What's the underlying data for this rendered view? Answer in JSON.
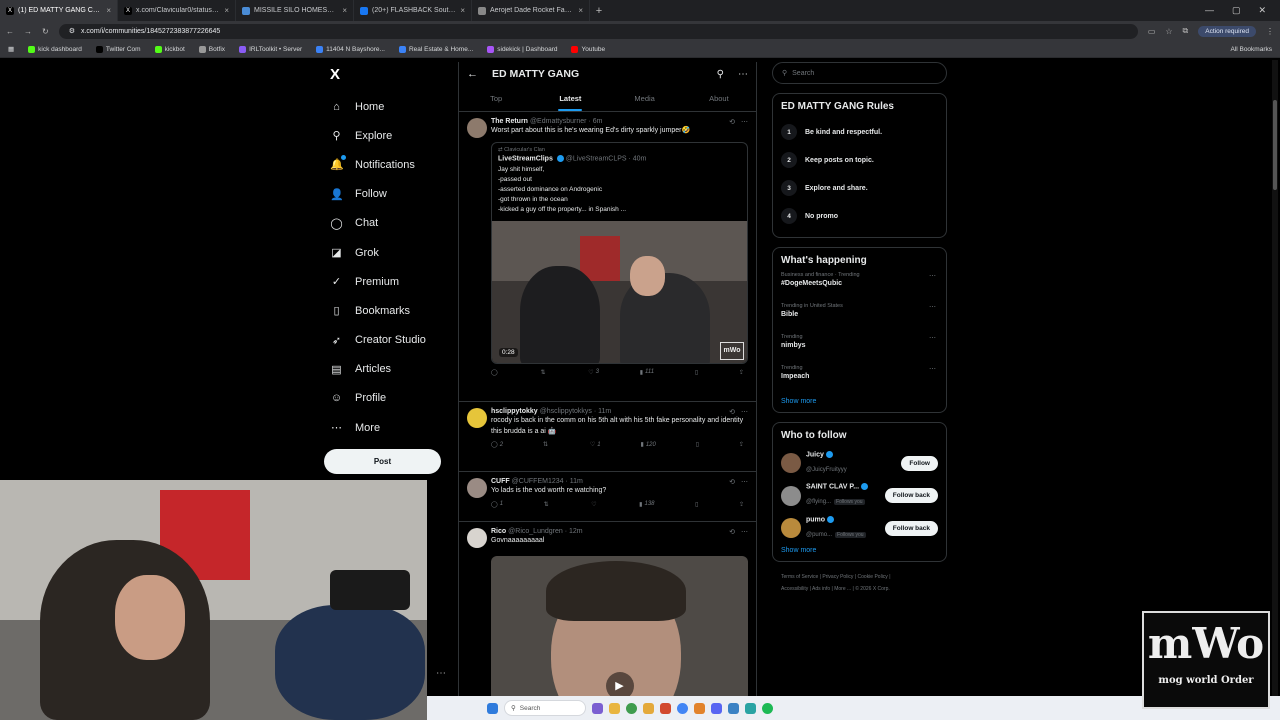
{
  "browser": {
    "tabs": [
      {
        "title": "(1) ED MATTY GANG Communities / X",
        "icon": "x-icon",
        "active": true
      },
      {
        "title": "x.com/Clavicular0/status/2039...",
        "icon": "x-icon",
        "active": false
      },
      {
        "title": "MISSILE SILO HOMESTEAD - Go...",
        "icon": "globe-icon",
        "active": false
      },
      {
        "title": "(20+) FLASHBACK South Florid...",
        "icon": "facebook-icon",
        "active": false
      },
      {
        "title": "Aerojet Dade Rocket Facility | A...",
        "icon": "page-icon",
        "active": false
      }
    ],
    "url": "x.com/i/communities/1845272383877226645",
    "action_required": "Action required",
    "bookmarks": [
      "kick dashboard",
      "Twitter Com",
      "kickbot",
      "Botfix",
      "IRLToolkit • Server",
      "11404 N Bayshore...",
      "Real Estate & Home...",
      "sidekick | Dashboard",
      "Youtube"
    ],
    "all_bookmarks": "All Bookmarks"
  },
  "nav": {
    "logo": "X",
    "items": [
      {
        "label": "Home",
        "icon": "home-icon",
        "glyph": "⌂"
      },
      {
        "label": "Explore",
        "icon": "search-icon",
        "glyph": "⚲"
      },
      {
        "label": "Notifications",
        "icon": "bell-icon",
        "glyph": "🔔"
      },
      {
        "label": "Follow",
        "icon": "follow-icon",
        "glyph": "👤"
      },
      {
        "label": "Chat",
        "icon": "chat-icon",
        "glyph": "◯"
      },
      {
        "label": "Grok",
        "icon": "grok-icon",
        "glyph": "◪"
      },
      {
        "label": "Premium",
        "icon": "premium-icon",
        "glyph": "✓"
      },
      {
        "label": "Bookmarks",
        "icon": "bookmark-icon",
        "glyph": "▯"
      },
      {
        "label": "Creator Studio",
        "icon": "rocket-icon",
        "glyph": "➶"
      },
      {
        "label": "Articles",
        "icon": "articles-icon",
        "glyph": "▤"
      },
      {
        "label": "Profile",
        "icon": "profile-icon",
        "glyph": "☺"
      },
      {
        "label": "More",
        "icon": "more-icon",
        "glyph": "⋯"
      }
    ],
    "post_label": "Post"
  },
  "community": {
    "title": "ED MATTY GANG",
    "tabs": [
      "Top",
      "Latest",
      "Media",
      "About"
    ],
    "active_tab": "Latest"
  },
  "posts": [
    {
      "name": "The Return",
      "handle": "@Edmattysburner · 6m",
      "text": "Worst part about this is he's wearing Ed's dirty sparkly jumper🤣",
      "quote": {
        "context": "Clavicular's Clan",
        "name": "LiveStreamClips",
        "handle": "@LiveStreamCLPS · 40m",
        "lines": [
          "Jay shit himself,",
          "-passed out",
          "-asserted dominance on Androgenic",
          "-got thrown in the ocean",
          "-kicked a guy off the property... in Spanish ..."
        ],
        "duration": "0:28",
        "watermark": "mWo"
      },
      "actions": {
        "replies": "",
        "reposts": "",
        "likes": "3",
        "views": "111"
      }
    },
    {
      "name": "hsclippytokky",
      "handle": "@hsclippytokkys · 11m",
      "text": "rocody is back in the comm on his 5th alt with his 5th fake personality and identity",
      "text2": "this brudda is a ai 🤖",
      "actions": {
        "replies": "2",
        "reposts": "",
        "likes": "1",
        "views": "120"
      }
    },
    {
      "name": "CUFF",
      "handle": "@CUFFEM1234 · 11m",
      "text": "Yo lads is the vod worth re watching?",
      "actions": {
        "replies": "1",
        "reposts": "",
        "likes": "",
        "views": "138"
      }
    },
    {
      "name": "Rico",
      "handle": "@Rico_Lundgren · 12m",
      "text": "Govnaaaaaaaaal"
    }
  ],
  "right": {
    "search_placeholder": "Search",
    "rules_title": "ED MATTY GANG Rules",
    "rules": [
      {
        "n": "1",
        "text": "Be kind and respectful."
      },
      {
        "n": "2",
        "text": "Keep posts on topic."
      },
      {
        "n": "3",
        "text": "Explore and share."
      },
      {
        "n": "4",
        "text": "No promo"
      }
    ],
    "happening_title": "What's happening",
    "trends": [
      {
        "context": "Business and finance · Trending",
        "name": "#DogeMeetsQubic"
      },
      {
        "context": "Trending in United States",
        "name": "Bible"
      },
      {
        "context": "Trending",
        "name": "nimbys"
      },
      {
        "context": "Trending",
        "name": "Impeach"
      }
    ],
    "show_more": "Show more",
    "wtf_title": "Who to follow",
    "who_to_follow": [
      {
        "name": "Juicy",
        "handle": "@JuicyFruityyy",
        "button": "Follow",
        "follows_you": ""
      },
      {
        "name": "SAINT CLAV P...",
        "handle": "@flying...",
        "button": "Follow back",
        "follows_you": "Follows you"
      },
      {
        "name": "pumo",
        "handle": "@pumo...",
        "button": "Follow back",
        "follows_you": "Follows you"
      }
    ],
    "footer": [
      "Terms of Service",
      "Privacy Policy",
      "Cookie Policy",
      "Accessibility",
      "Ads info",
      "More ...",
      "© 2026 X Corp."
    ]
  },
  "taskbar": {
    "search": "Search"
  },
  "overlay": {
    "logo_big": "mWo",
    "logo_small": "mog world Order"
  }
}
